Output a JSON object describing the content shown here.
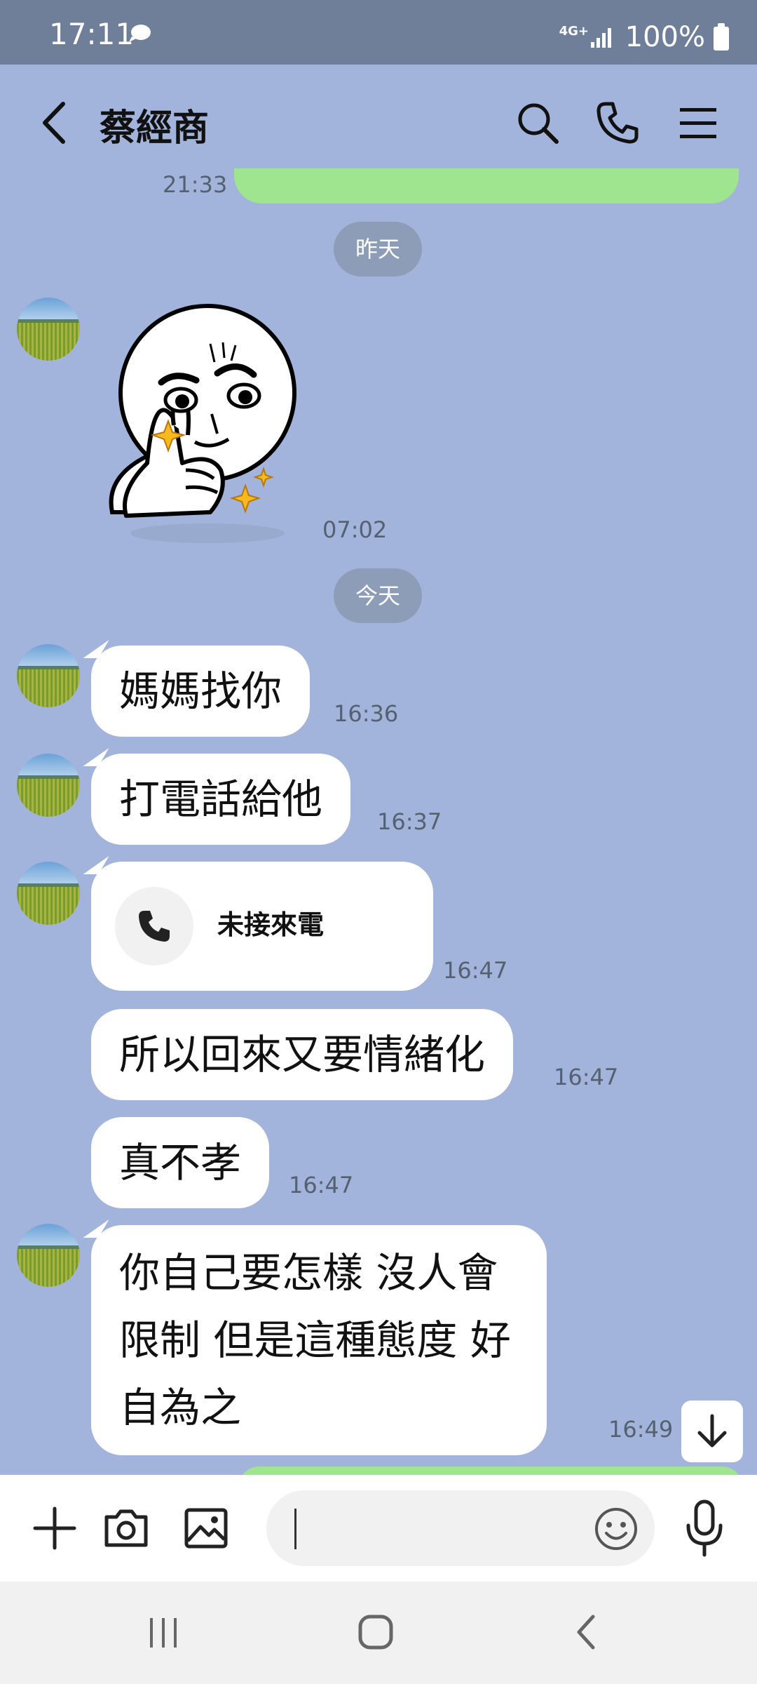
{
  "status_bar": {
    "time": "17:11",
    "network": "4G+",
    "battery": "100%"
  },
  "header": {
    "title": "蔡經商"
  },
  "messages": {
    "prev_time": "21:33",
    "day_yesterday": "昨天",
    "sticker_time": "07:02",
    "day_today": "今天",
    "m1_text": "媽媽找你",
    "m1_time": "16:36",
    "m2_text": "打電話給他",
    "m2_time": "16:37",
    "call_label": "未接來電",
    "call_time": "16:47",
    "m3_text": "所以回來又要情緒化",
    "m3_time": "16:47",
    "m4_text": "真不孝",
    "m4_time": "16:47",
    "m5_line1": "你自己要怎樣 沒人會",
    "m5_line2": "限制 但是這種態度 好",
    "m5_line3": "自為之",
    "m5_time": "16:49"
  },
  "input": {
    "value": ""
  },
  "colors": {
    "background": "#a2b4db",
    "my_bubble": "#9fe48f",
    "status_bar": "#6f7f99"
  }
}
